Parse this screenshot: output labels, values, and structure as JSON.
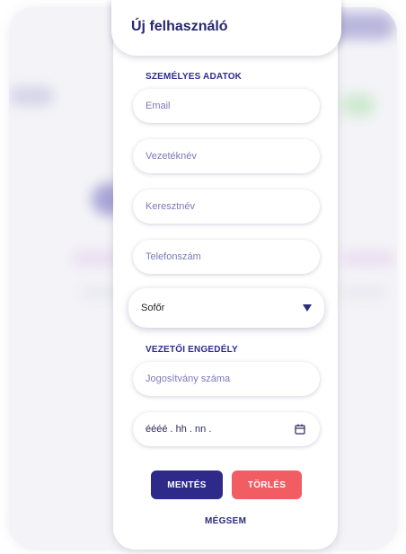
{
  "modal": {
    "title": "Új felhasználó",
    "personal_section": "SZEMÉLYES ADATOK",
    "fields": {
      "email": "Email",
      "last_name": "Vezetéknév",
      "first_name": "Keresztnév",
      "phone": "Telefonszám"
    },
    "role_select": {
      "value": "Sofőr"
    },
    "license_section": "VEZETŐI ENGEDÉLY",
    "license_number": "Jogosítvány száma",
    "date_placeholder": "éééé . hh . nn .",
    "buttons": {
      "save": "MENTÉS",
      "delete": "TÖRLÉS",
      "cancel": "MÉGSEM"
    }
  },
  "colors": {
    "accent": "#2d2a8a",
    "danger": "#f25c63",
    "title": "#29286e"
  }
}
